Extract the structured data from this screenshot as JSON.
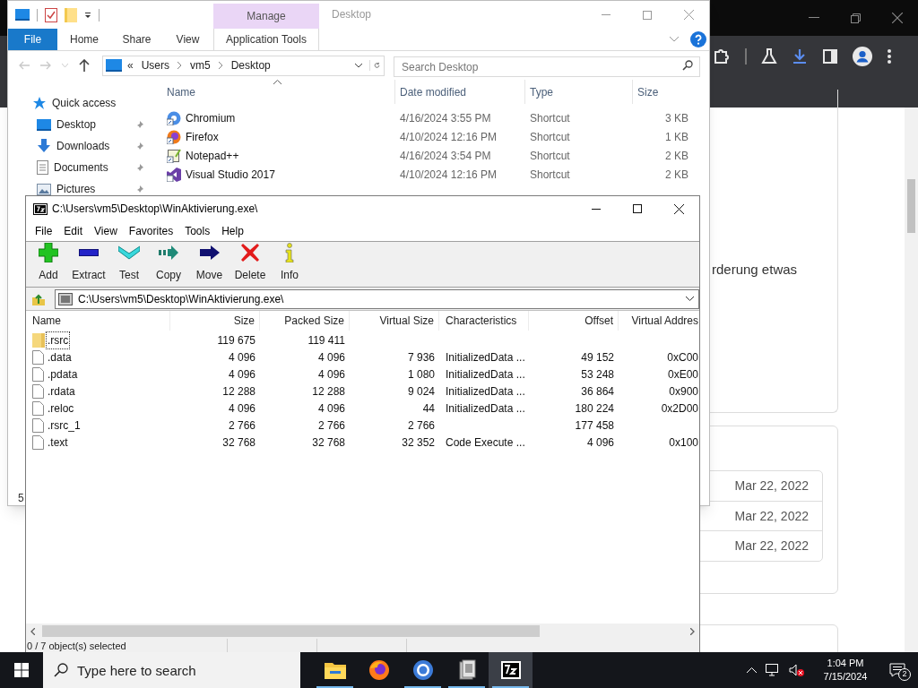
{
  "browser": {
    "text": "rderung etwas",
    "dates": [
      "Mar 22, 2022",
      "Mar 22, 2022",
      "Mar 22, 2022"
    ]
  },
  "explorer": {
    "context_tab": "Manage",
    "title": "Desktop",
    "ribbon_tabs": [
      {
        "label": "File",
        "kind": "file"
      },
      {
        "label": "Home",
        "kind": "tab"
      },
      {
        "label": "Share",
        "kind": "tab"
      },
      {
        "label": "View",
        "kind": "tab"
      },
      {
        "label": "Application Tools",
        "kind": "context"
      }
    ],
    "breadcrumb_overflow": "«",
    "breadcrumb": [
      "Users",
      "vm5",
      "Desktop"
    ],
    "search": {
      "placeholder": "Search Desktop"
    },
    "nav": [
      {
        "label": "Quick access",
        "kind": "quick",
        "pinned": false
      },
      {
        "label": "Desktop",
        "kind": "desktop",
        "pinned": true
      },
      {
        "label": "Downloads",
        "kind": "downloads",
        "pinned": true
      },
      {
        "label": "Documents",
        "kind": "documents",
        "pinned": true
      },
      {
        "label": "Pictures",
        "kind": "pictures",
        "pinned": true
      }
    ],
    "columns": [
      "Name",
      "Date modified",
      "Type",
      "Size"
    ],
    "rows": [
      {
        "kind": "chromium",
        "name": "Chromium",
        "date": "4/16/2024 3:55 PM",
        "type": "Shortcut",
        "size": "3 KB",
        "selected": false
      },
      {
        "kind": "firefox",
        "name": "Firefox",
        "date": "4/10/2024 12:16 PM",
        "type": "Shortcut",
        "size": "1 KB",
        "selected": false
      },
      {
        "kind": "notepad",
        "name": "Notepad++",
        "date": "4/16/2024 3:54 PM",
        "type": "Shortcut",
        "size": "2 KB",
        "selected": false
      },
      {
        "kind": "studio",
        "name": "Visual Studio 2017",
        "date": "4/10/2024 12:16 PM",
        "type": "Shortcut",
        "size": "2 KB",
        "selected": false
      }
    ],
    "status": "5"
  },
  "sevenzip": {
    "title": "C:\\Users\\vm5\\Desktop\\WinAktivierung.exe\\",
    "menu": [
      "File",
      "Edit",
      "View",
      "Favorites",
      "Tools",
      "Help"
    ],
    "toolbar": [
      {
        "kind": "add",
        "label": "Add"
      },
      {
        "kind": "extract",
        "label": "Extract"
      },
      {
        "kind": "test",
        "label": "Test"
      },
      {
        "kind": "copy",
        "label": "Copy"
      },
      {
        "kind": "move",
        "label": "Move"
      },
      {
        "kind": "delete",
        "label": "Delete"
      },
      {
        "kind": "info",
        "label": "Info"
      }
    ],
    "path": "C:\\Users\\vm5\\Desktop\\WinAktivierung.exe\\",
    "columns": [
      "Name",
      "Size",
      "Packed Size",
      "Virtual Size",
      "Characteristics",
      "Offset",
      "Virtual Addres"
    ],
    "rows": [
      {
        "kind": "folder",
        "focused": true,
        "name": ".rsrc",
        "size": "119 675",
        "packed_size": "119 411"
      },
      {
        "kind": "file",
        "focused": false,
        "name": ".data",
        "size": "4 096",
        "packed_size": "4 096",
        "virtual_size": "7 936",
        "characteristics": "InitializedData ...",
        "offset": "49 152",
        "virtual_address": "0xC00"
      },
      {
        "kind": "file",
        "focused": false,
        "name": ".pdata",
        "size": "4 096",
        "packed_size": "4 096",
        "virtual_size": "1 080",
        "characteristics": "InitializedData ...",
        "offset": "53 248",
        "virtual_address": "0xE00"
      },
      {
        "kind": "file",
        "focused": false,
        "name": ".rdata",
        "size": "12 288",
        "packed_size": "12 288",
        "virtual_size": "9 024",
        "characteristics": "InitializedData ...",
        "offset": "36 864",
        "virtual_address": "0x900"
      },
      {
        "kind": "file",
        "focused": false,
        "name": ".reloc",
        "size": "4 096",
        "packed_size": "4 096",
        "virtual_size": "44",
        "characteristics": "InitializedData ...",
        "offset": "180 224",
        "virtual_address": "0x2D00"
      },
      {
        "kind": "file",
        "focused": false,
        "name": ".rsrc_1",
        "size": "2 766",
        "packed_size": "2 766",
        "virtual_size": "2 766",
        "offset": "177 458"
      },
      {
        "kind": "file",
        "focused": false,
        "name": ".text",
        "size": "32 768",
        "packed_size": "32 768",
        "virtual_size": "32 352",
        "characteristics": "Code Execute ...",
        "offset": "4 096",
        "virtual_address": "0x100"
      }
    ],
    "status": "0 / 7 object(s) selected"
  },
  "taskbar": {
    "search": {
      "placeholder": "Type here to search"
    },
    "apps": [
      {
        "kind": "explorer",
        "running": true,
        "active": false
      },
      {
        "kind": "firefox",
        "running": false,
        "active": false
      },
      {
        "kind": "chrome",
        "running": true,
        "active": false
      },
      {
        "kind": "archive",
        "running": true,
        "active": false
      },
      {
        "kind": "sevenzip",
        "running": true,
        "active": true
      }
    ],
    "time": "1:04 PM",
    "date": "7/15/2024",
    "notifications": "2"
  }
}
